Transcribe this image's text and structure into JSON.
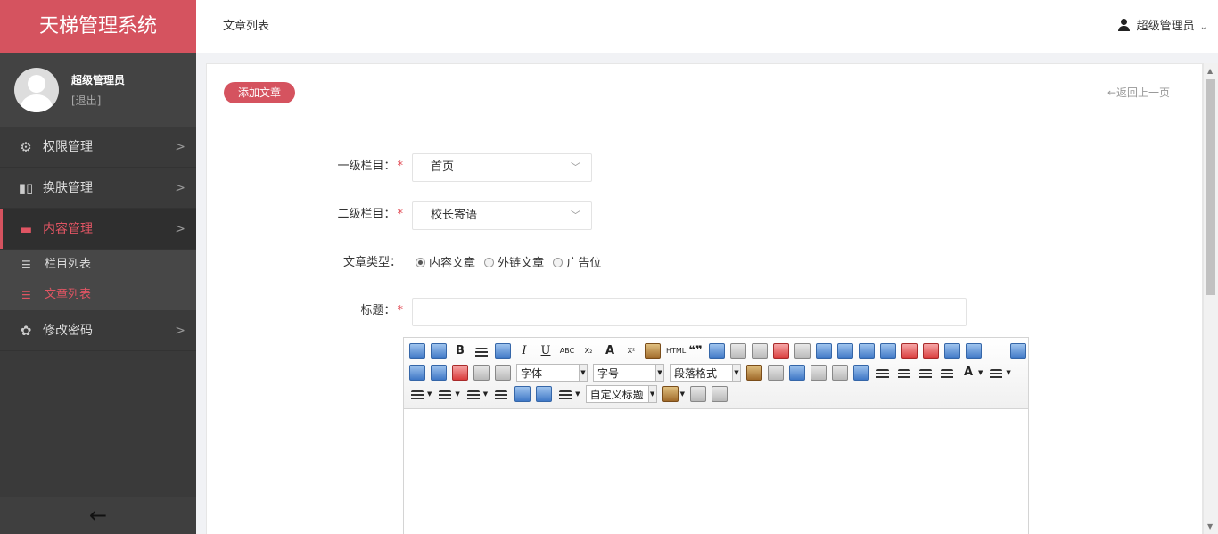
{
  "app": {
    "title": "天梯管理系统"
  },
  "profile": {
    "name": "超级管理员",
    "logout": "[退出]"
  },
  "sidebar": {
    "items": [
      {
        "label": "权限管理",
        "icon": "gear-icon"
      },
      {
        "label": "换肤管理",
        "icon": "book-icon"
      },
      {
        "label": "内容管理",
        "icon": "folder-icon"
      },
      {
        "label": "修改密码",
        "icon": "cog-icon"
      }
    ],
    "sub_items": [
      {
        "label": "栏目列表",
        "icon": "list-icon"
      },
      {
        "label": "文章列表",
        "icon": "list-icon"
      }
    ],
    "collapse_icon": "arrow-left-icon"
  },
  "header": {
    "title": "文章列表",
    "user": "超级管理员"
  },
  "main": {
    "add_button": "添加文章",
    "back_link": "←返回上一页",
    "form": {
      "level1_label": "一级栏目：",
      "level1_value": "首页",
      "level2_label": "二级栏目：",
      "level2_value": "校长寄语",
      "type_label": "文章类型：",
      "type_options": [
        "内容文章",
        "外链文章",
        "广告位"
      ],
      "type_selected": "内容文章",
      "title_label": "标题：",
      "title_value": "",
      "required_mark": "*"
    },
    "editor": {
      "font_combo": "字体",
      "size_combo": "字号",
      "para_combo": "段落格式",
      "custom_combo": "自定义标题",
      "bold": "B",
      "italic": "I",
      "underline": "U",
      "strike": "ABC",
      "subscript": "X₂",
      "fontborder": "A",
      "superscript": "X²",
      "html": "HTML",
      "quote": "❝❞",
      "forecolor": "A"
    }
  },
  "colors": {
    "accent": "#d5535f",
    "sidebar": "#3a3a3a"
  }
}
